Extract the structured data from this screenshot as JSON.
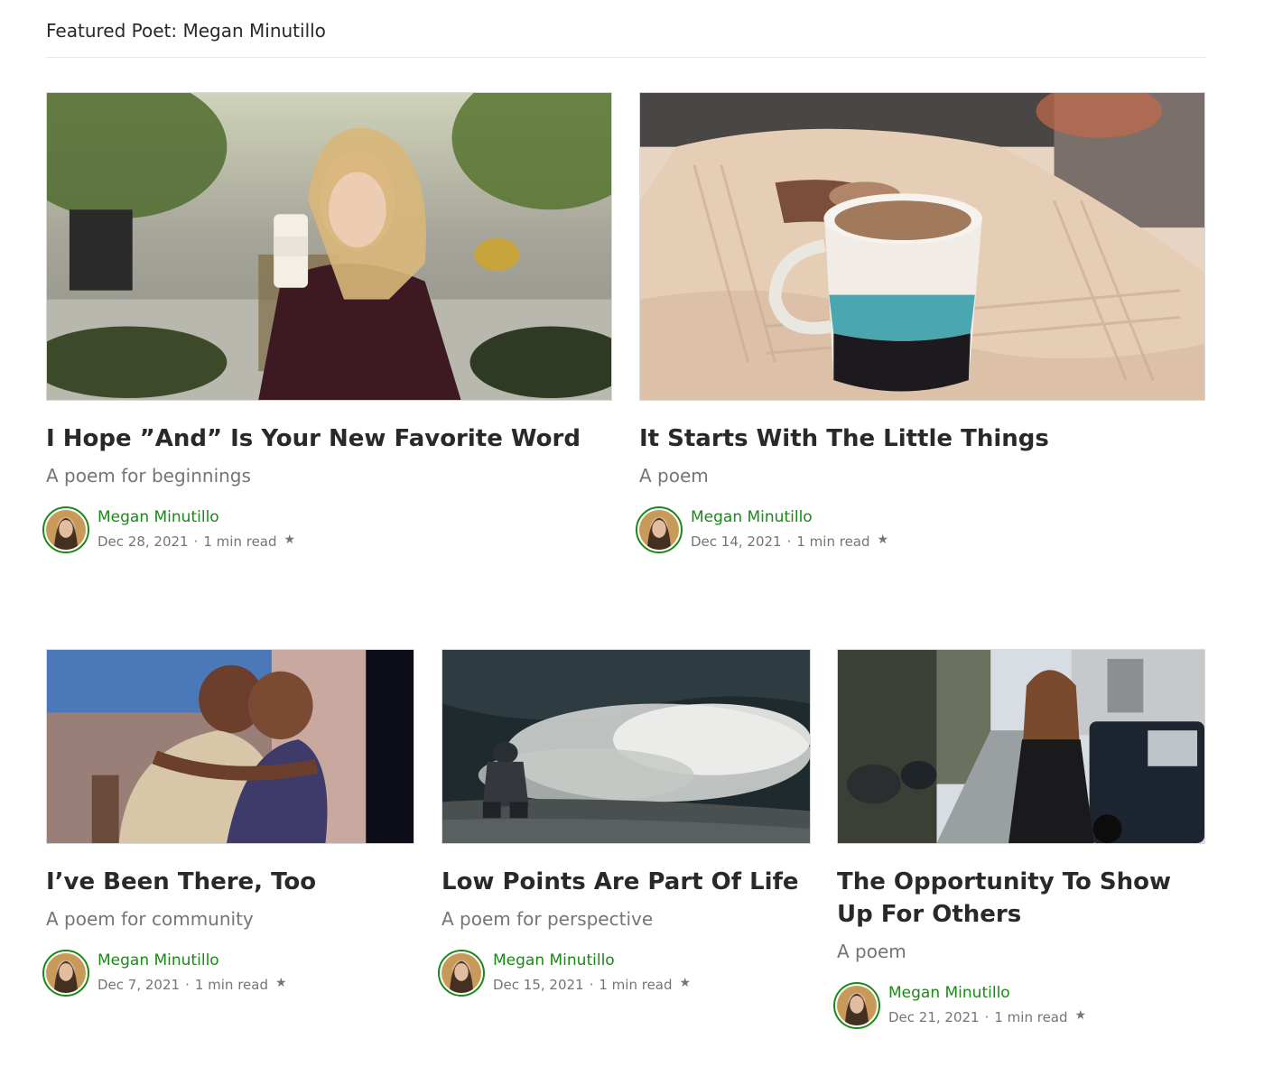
{
  "section": {
    "title": "Featured Poet: Megan Minutillo"
  },
  "cards": [
    {
      "title": "I Hope ”And” Is Your New Favorite Word",
      "subtitle": "A poem for beginnings",
      "author": "Megan Minutillo",
      "date": "Dec 28, 2021",
      "read_time": "1 min read",
      "star": "★"
    },
    {
      "title": "It Starts With The Little Things",
      "subtitle": "A poem",
      "author": "Megan Minutillo",
      "date": "Dec 14, 2021",
      "read_time": "1 min read",
      "star": "★"
    },
    {
      "title": "I’ve Been There, Too",
      "subtitle": "A poem for community",
      "author": "Megan Minutillo",
      "date": "Dec 7, 2021",
      "read_time": "1 min read",
      "star": "★"
    },
    {
      "title": "Low Points Are Part Of Life",
      "subtitle": "A poem for perspective",
      "author": "Megan Minutillo",
      "date": "Dec 15, 2021",
      "read_time": "1 min read",
      "star": "★"
    },
    {
      "title": "The Opportunity To Show Up For Others",
      "subtitle": "A poem",
      "author": "Megan Minutillo",
      "date": "Dec 21, 2021",
      "read_time": "1 min read",
      "star": "★"
    }
  ],
  "separator": "·",
  "colors": {
    "author": "#1a8917",
    "text": "#292929",
    "muted": "#757575"
  }
}
